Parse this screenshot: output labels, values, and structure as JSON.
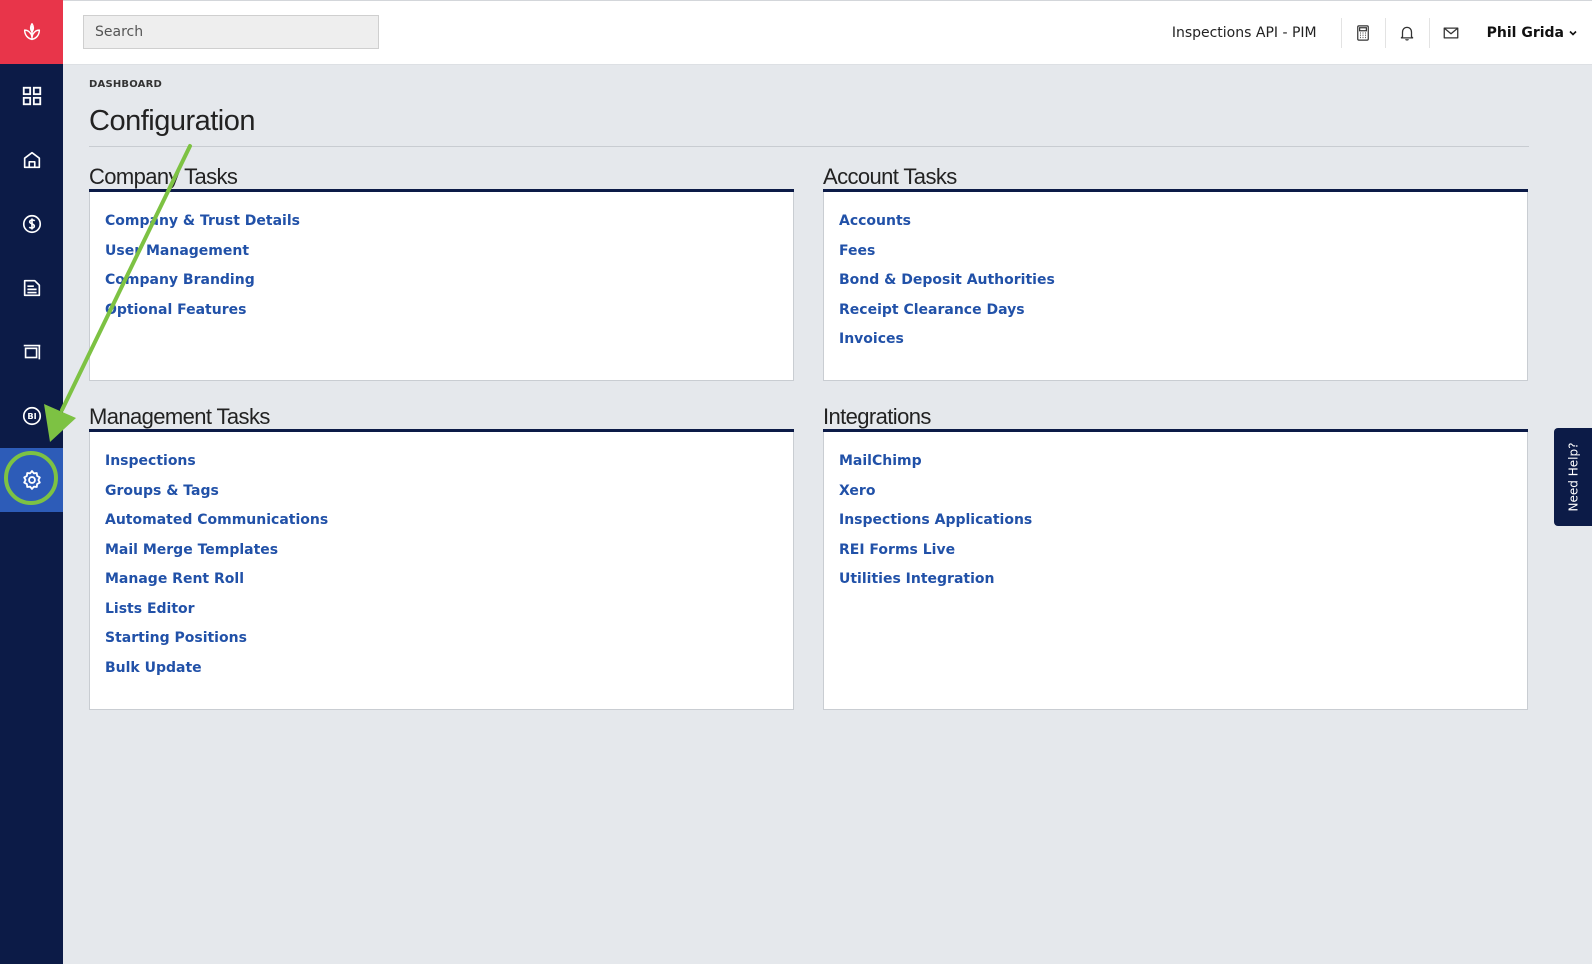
{
  "search": {
    "placeholder": "Search"
  },
  "header": {
    "company": "Inspections API - PIM",
    "user_name": "Phil Grida"
  },
  "sidebar": {
    "items": [
      {
        "name": "dashboard",
        "icon": "grid-icon"
      },
      {
        "name": "properties",
        "icon": "house-icon"
      },
      {
        "name": "financials",
        "icon": "dollar-icon"
      },
      {
        "name": "reports",
        "icon": "document-icon"
      },
      {
        "name": "inspections",
        "icon": "frame-icon"
      },
      {
        "name": "business-intelligence",
        "icon": "bi-icon"
      },
      {
        "name": "configuration",
        "icon": "gear-icon",
        "active": true
      }
    ]
  },
  "breadcrumb": "DASHBOARD",
  "page_title": "Configuration",
  "panels": {
    "company_tasks": {
      "title": "Company Tasks",
      "links": [
        "Company & Trust Details",
        "User Management",
        "Company Branding",
        "Optional Features"
      ]
    },
    "account_tasks": {
      "title": "Account Tasks",
      "links": [
        "Accounts",
        "Fees",
        "Bond & Deposit Authorities",
        "Receipt Clearance Days",
        "Invoices"
      ]
    },
    "management_tasks": {
      "title": "Management Tasks",
      "links": [
        "Inspections",
        "Groups & Tags",
        "Automated Communications",
        "Mail Merge Templates",
        "Manage Rent Roll",
        "Lists Editor",
        "Starting Positions",
        "Bulk Update"
      ]
    },
    "integrations": {
      "title": "Integrations",
      "links": [
        "MailChimp",
        "Xero",
        "Inspections Applications",
        "REI Forms Live",
        "Utilities Integration"
      ]
    }
  },
  "help_tab": "Need Help?",
  "colors": {
    "sidebar": "#0c1b47",
    "logo_bg": "#e8354a",
    "active_nav": "#2d5cb8",
    "link": "#2151a8",
    "annotation": "#7dc243"
  }
}
